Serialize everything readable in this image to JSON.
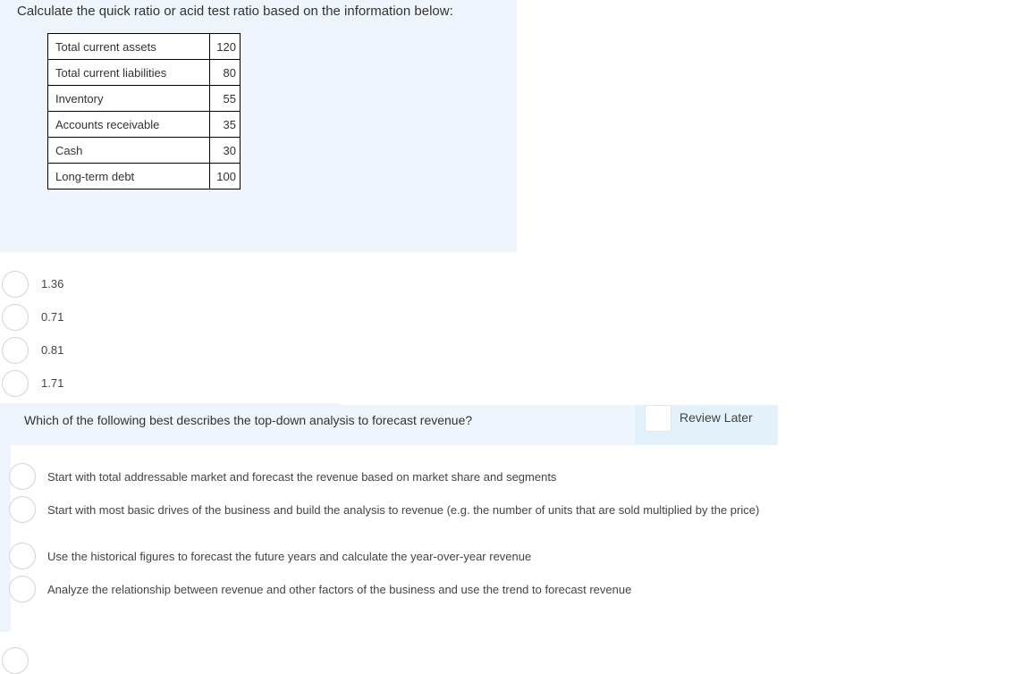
{
  "question1": {
    "prompt": "Calculate the quick ratio or acid test ratio based on the information below:",
    "table": [
      {
        "label": "Total current assets",
        "value": "120"
      },
      {
        "label": "Total current liabilities",
        "value": "80"
      },
      {
        "label": "Inventory",
        "value": "55"
      },
      {
        "label": "Accounts receivable",
        "value": "35"
      },
      {
        "label": "Cash",
        "value": "30"
      },
      {
        "label": "Long-term debt",
        "value": "100"
      }
    ],
    "options": [
      "1.36",
      "0.71",
      "0.81",
      "1.71"
    ]
  },
  "question2": {
    "prompt": "Which of the following best describes the top-down analysis to forecast revenue?",
    "review_later_label": "Review Later",
    "options": [
      "Start with total addressable market and forecast the revenue based on market share and segments",
      "Start with most basic drives of the business and build the analysis to revenue (e.g. the number of units that are sold multiplied by the price)",
      "Use the historical figures to forecast the future years and calculate the year-over-year revenue",
      "Analyze the relationship between revenue and other factors of the business and use the trend to forecast revenue"
    ]
  }
}
